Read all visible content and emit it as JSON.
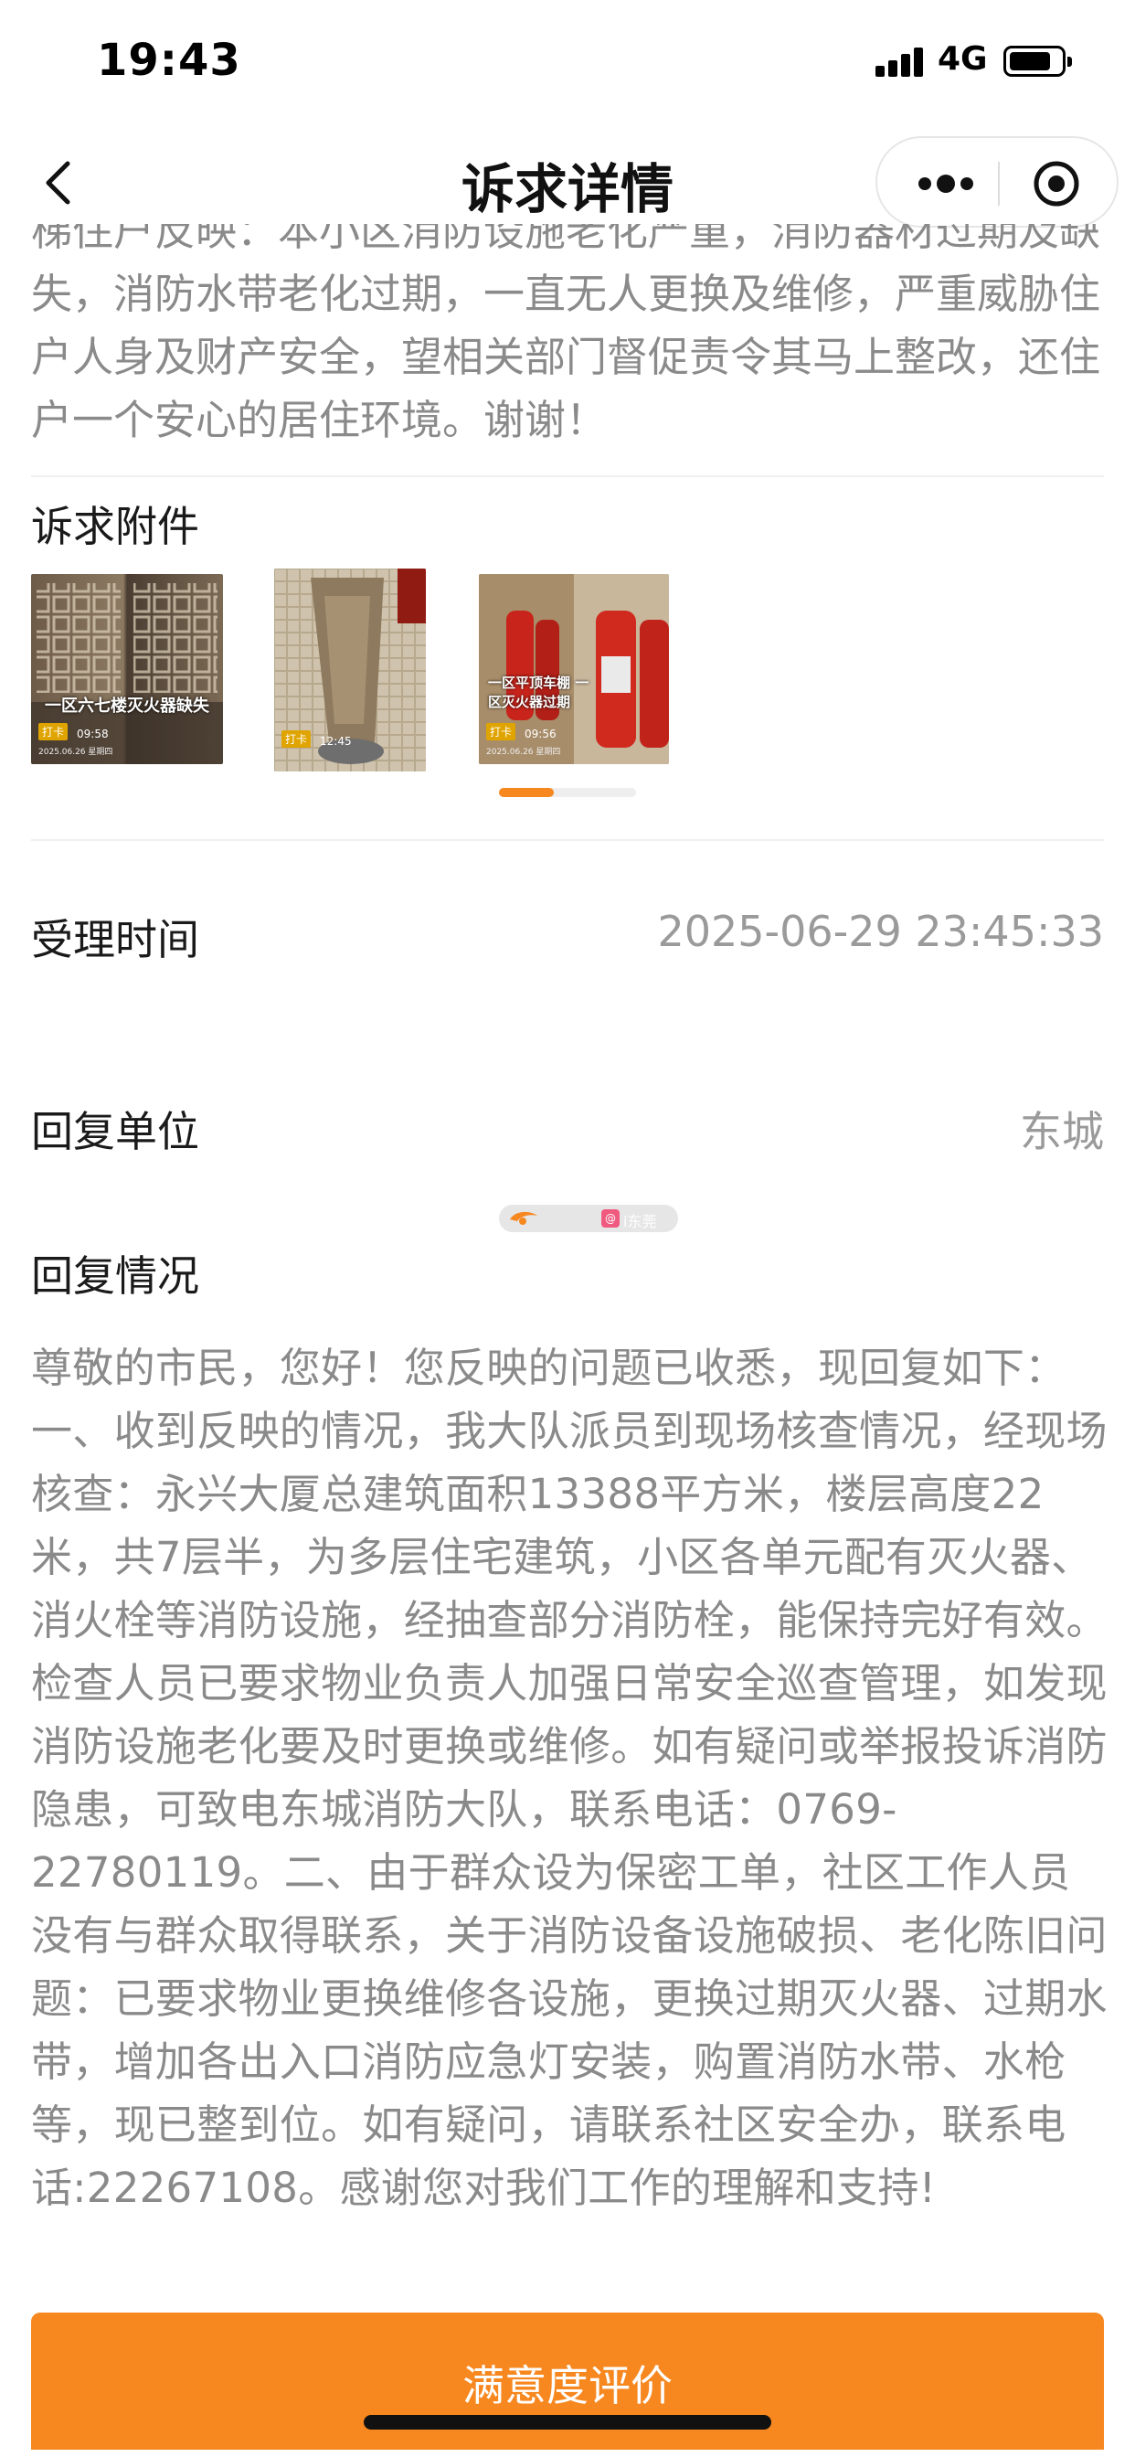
{
  "status_bar": {
    "time": "19:43",
    "network": "4G"
  },
  "nav": {
    "title": "诉求详情"
  },
  "complaint": {
    "text": "梯住户反映：本小区消防设施老化严重，消防器材过期及缺失，消防水带老化过期，一直无人更换及维修，严重威胁住户人身及财产安全，望相关部门督促责令其马上整改，还住户一个安心的居住环境。谢谢！"
  },
  "attachments": {
    "title": "诉求附件",
    "items": [
      {
        "caption": "一区六七楼灭火器缺失",
        "stamp": "打卡",
        "time": "09:58",
        "footer": "2025.06.26 星期四"
      },
      {
        "caption": "",
        "stamp": "打卡",
        "time": "12:45",
        "footer": ""
      },
      {
        "caption": "一区平顶车棚 一区灭火器过期",
        "stamp": "打卡",
        "time": "09:56",
        "footer": "2025.06.26 星期四"
      }
    ],
    "page_index": 1,
    "page_count": 3
  },
  "accept_time": {
    "label": "受理时间",
    "value": "2025-06-29 23:45:33"
  },
  "reply_unit": {
    "label": "回复单位",
    "value": "东城"
  },
  "reply": {
    "title": "回复情况",
    "text": "尊敬的市民，您好！您反映的问题已收悉，现回复如下：一、收到反映的情况，我大队派员到现场核查情况，经现场核查：永兴大厦总建筑面积13388平方米，楼层高度22米，共7层半，为多层住宅建筑，小区各单元配有灭火器、消火栓等消防设施，经抽查部分消防栓，能保持完好有效。检查人员已要求物业负责人加强日常安全巡查管理，如发现消防设施老化要及时更换或维修。如有疑问或举报投诉消防隐患，可致电东城消防大队，联系电话：0769-22780119。二、由于群众设为保密工单，社区工作人员没有与群众取得联系，关于消防设备设施破损、老化陈旧问题：已要求物业更换维修各设施，更换过期灭火器、过期水带，增加各出入口消防应急灯安装，购置消防水带、水枪等，现已整到位。如有疑问，请联系社区安全办，联系电话:22267108。感谢您对我们工作的理解和支持!"
  },
  "watermark": {
    "text": "",
    "badge": "@",
    "handle": "i东莞"
  },
  "bottom": {
    "button_label": "满意度评价"
  },
  "colors": {
    "accent": "#f7871f",
    "muted_text": "#8a8a8a",
    "value_text": "#9a9a9a"
  }
}
